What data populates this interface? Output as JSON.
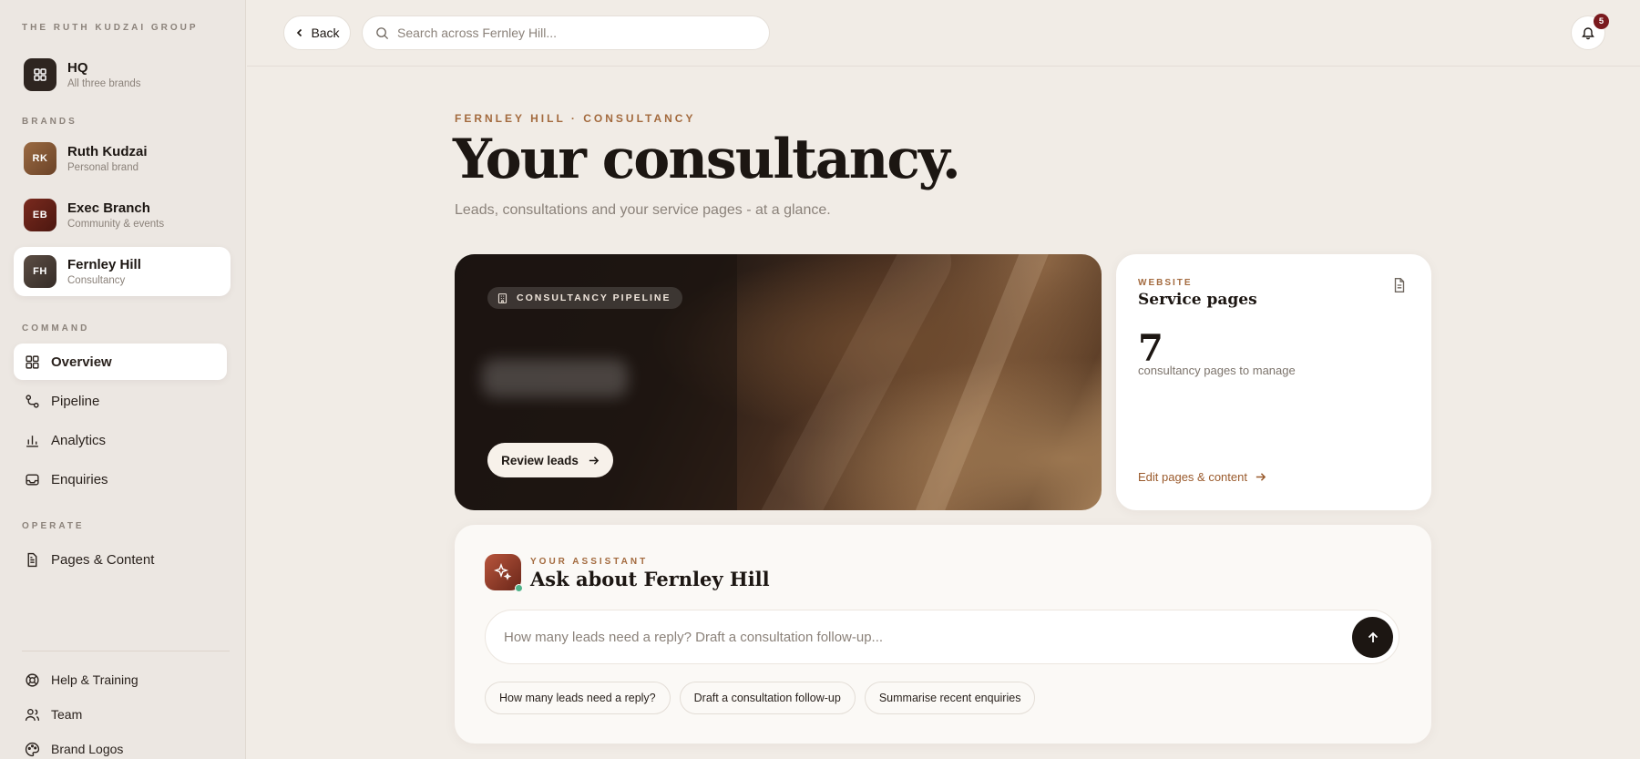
{
  "sidebar": {
    "group_label": "THE RUTH KUDZAI GROUP",
    "hq": {
      "initials": "",
      "name": "HQ",
      "sub": "All three brands"
    },
    "brands_label": "BRANDS",
    "brands": [
      {
        "initials": "RK",
        "name": "Ruth Kudzai",
        "sub": "Personal brand"
      },
      {
        "initials": "EB",
        "name": "Exec Branch",
        "sub": "Community & events"
      },
      {
        "initials": "FH",
        "name": "Fernley Hill",
        "sub": "Consultancy"
      }
    ],
    "command_label": "COMMAND",
    "command_items": [
      {
        "label": "Overview",
        "icon": "grid-icon"
      },
      {
        "label": "Pipeline",
        "icon": "pipeline-icon"
      },
      {
        "label": "Analytics",
        "icon": "bar-chart-icon"
      },
      {
        "label": "Enquiries",
        "icon": "inbox-icon"
      }
    ],
    "operate_label": "OPERATE",
    "operate_items": [
      {
        "label": "Pages & Content",
        "icon": "document-icon"
      }
    ],
    "footer_items": [
      {
        "label": "Help & Training",
        "icon": "lifebuoy-icon"
      },
      {
        "label": "Team",
        "icon": "team-icon"
      },
      {
        "label": "Brand Logos",
        "icon": "palette-icon"
      }
    ]
  },
  "topbar": {
    "back_label": "Back",
    "search_placeholder": "Search across Fernley Hill...",
    "notifications_count": "5"
  },
  "main": {
    "eyebrow": "FERNLEY HILL · CONSULTANCY",
    "title": "Your consultancy.",
    "subtitle": "Leads, consultations and your service pages - at a glance.",
    "hero": {
      "chip": "CONSULTANCY PIPELINE",
      "button": "Review leads"
    },
    "service_card": {
      "eyebrow": "WEBSITE",
      "title": "Service pages",
      "count": "7",
      "desc": "consultancy pages to manage",
      "link": "Edit pages & content"
    },
    "assistant": {
      "eyebrow": "YOUR ASSISTANT",
      "title": "Ask about Fernley Hill",
      "placeholder": "How many leads need a reply? Draft a consultation follow-up...",
      "suggestions": [
        "How many leads need a reply?",
        "Draft a consultation follow-up",
        "Summarise recent enquiries"
      ]
    }
  },
  "colors": {
    "accent": "#a36a3e",
    "badge": "#7a1a1e",
    "status_online": "#4fb38a"
  }
}
